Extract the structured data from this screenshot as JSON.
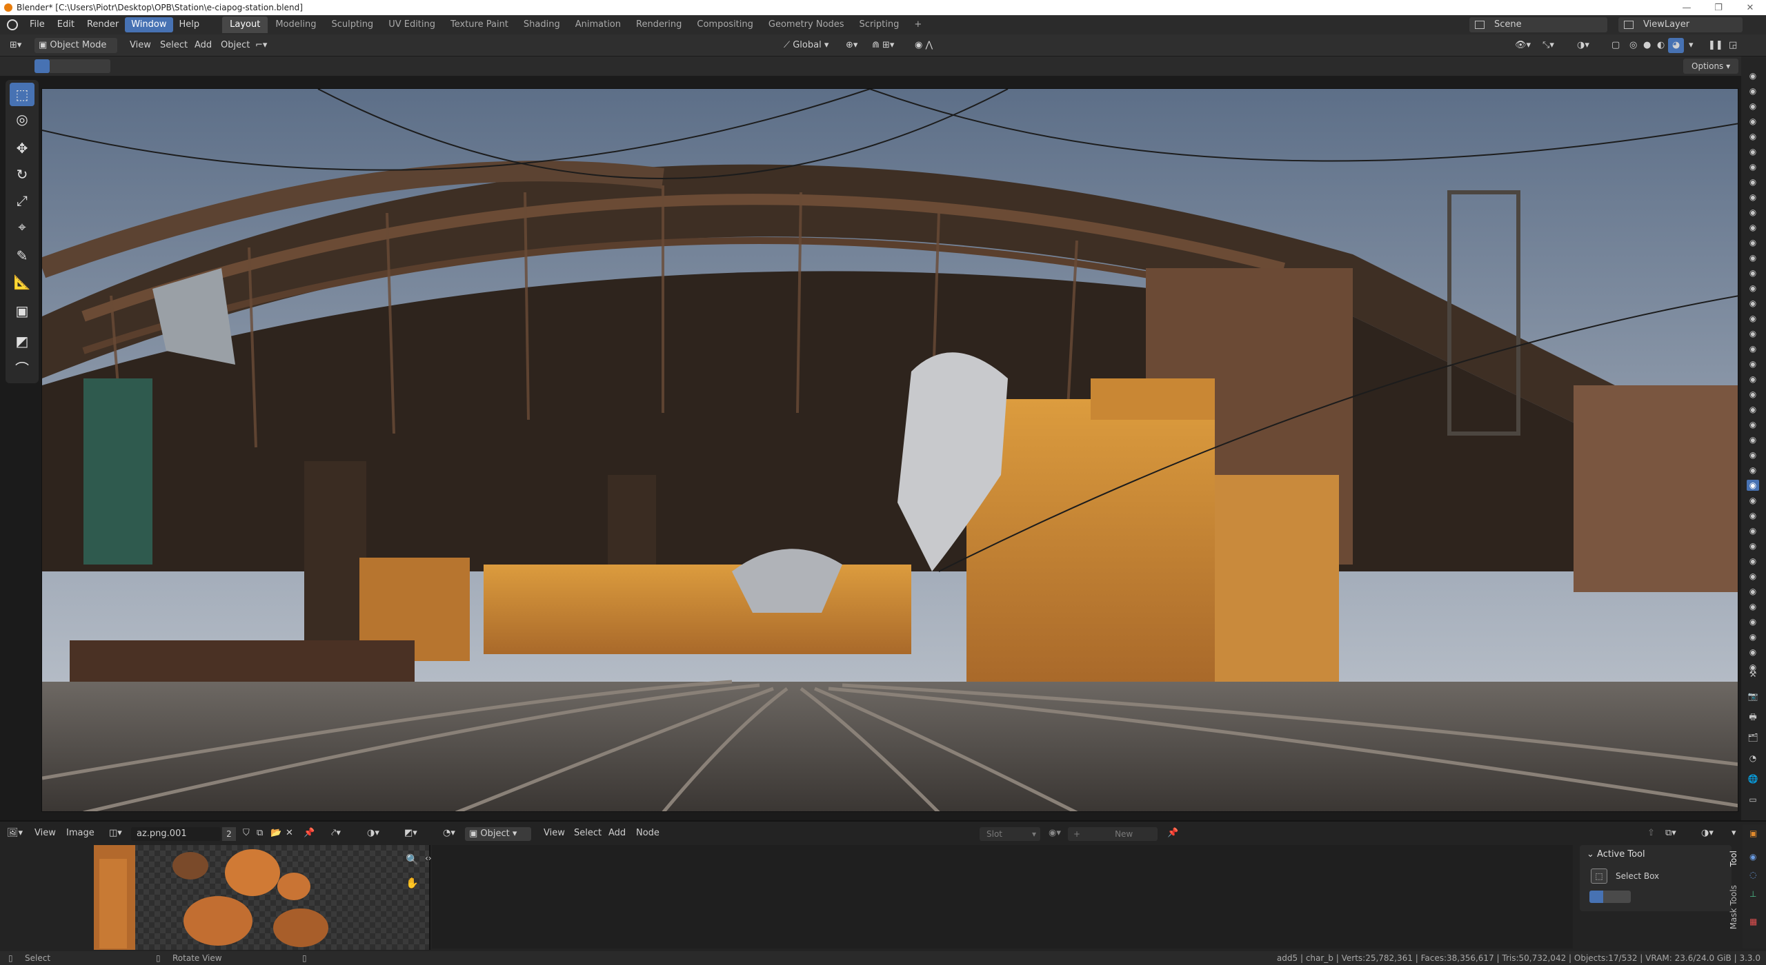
{
  "window": {
    "title": "Blender* [C:\\Users\\Piotr\\Desktop\\OPB\\Station\\e-ciapog-station.blend]"
  },
  "menu": [
    "File",
    "Edit",
    "Render",
    "Window",
    "Help"
  ],
  "workspaces": [
    "Layout",
    "Modeling",
    "Sculpting",
    "UV Editing",
    "Texture Paint",
    "Shading",
    "Animation",
    "Rendering",
    "Compositing",
    "Geometry Nodes",
    "Scripting"
  ],
  "scene": {
    "label": "Scene",
    "view_layer": "ViewLayer"
  },
  "viewport_header": {
    "mode": "Object Mode",
    "view": "View",
    "select": "Select",
    "add": "Add",
    "object": "Object",
    "orientation": "Global",
    "options": "Options"
  },
  "image_editor": {
    "view": "View",
    "image": "Image",
    "image_name": "az.png.001",
    "users": "2"
  },
  "node_editor": {
    "type": "Object",
    "view": "View",
    "select": "Select",
    "add": "Add",
    "node": "Node",
    "slot": "Slot",
    "new": "New"
  },
  "active_tool": {
    "title": "Active Tool",
    "tool": "Select Box"
  },
  "side_tabs": {
    "tool": "Tool",
    "mask_tools": "Mask Tools"
  },
  "status": {
    "select": "Select",
    "rotate": "Rotate View",
    "stats": "add5 | char_b | Verts:25,782,361 | Faces:38,356,617 | Tris:50,732,042 | Objects:17/532 | VRAM: 23.6/24.0 GiB | 3.3.0"
  }
}
